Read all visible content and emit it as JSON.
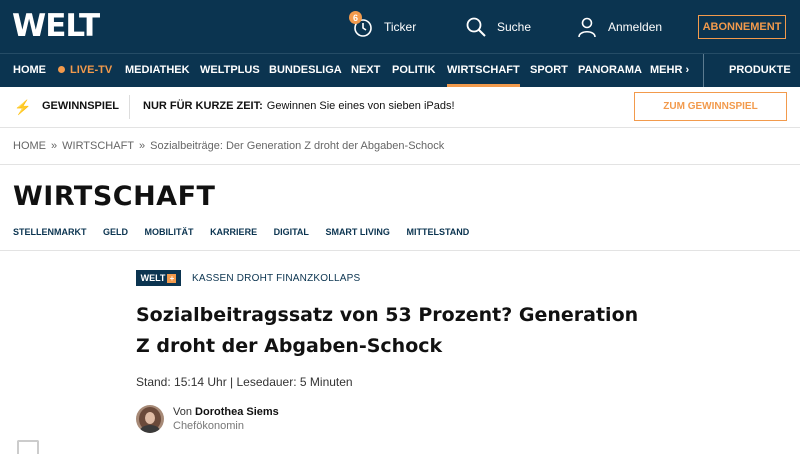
{
  "header": {
    "logo": "WELT",
    "ticker": {
      "label": "Ticker",
      "count": "6"
    },
    "search_label": "Suche",
    "login_label": "Anmelden",
    "subscribe_label": "ABONNEMENT"
  },
  "nav": {
    "items": [
      "HOME",
      "LIVE-TV",
      "MEDIATHEK",
      "WELTPLUS",
      "BUNDESLIGA",
      "NEXT",
      "POLITIK",
      "WIRTSCHAFT",
      "SPORT",
      "PANORAMA",
      "MEHR"
    ],
    "active": "WIRTSCHAFT",
    "products_label": "PRODUKTE"
  },
  "promo": {
    "label": "GEWINNSPIEL",
    "text_bold": "NUR FÜR KURZE ZEIT:",
    "text": "Gewinnen Sie eines von sieben iPads!",
    "button": "ZUM GEWINNSPIEL"
  },
  "breadcrumb": {
    "items": [
      "HOME",
      "WIRTSCHAFT",
      "Sozialbeiträge: Der Generation Z droht der Abgaben-Schock"
    ],
    "separator": "»"
  },
  "section": {
    "title": "WIRTSCHAFT",
    "subnav": [
      "STELLENMARKT",
      "GELD",
      "MOBILITÄT",
      "KARRIERE",
      "DIGITAL",
      "SMART LIVING",
      "MITTELSTAND"
    ]
  },
  "article": {
    "badge": "WELT",
    "badge_plus": "+",
    "kicker": "KASSEN DROHT FINANZKOLLAPS",
    "headline": "Sozialbeitragssatz von 53 Prozent? Generation Z droht der Abgaben-Schock",
    "meta": "Stand: 15:14 Uhr | Lesedauer: 5 Minuten",
    "author_prefix": "Von",
    "author_name": "Dorothea Siems",
    "author_role": "Chefökonomin"
  },
  "colors": {
    "navy": "#0b3450",
    "accent": "#f29a4c"
  }
}
